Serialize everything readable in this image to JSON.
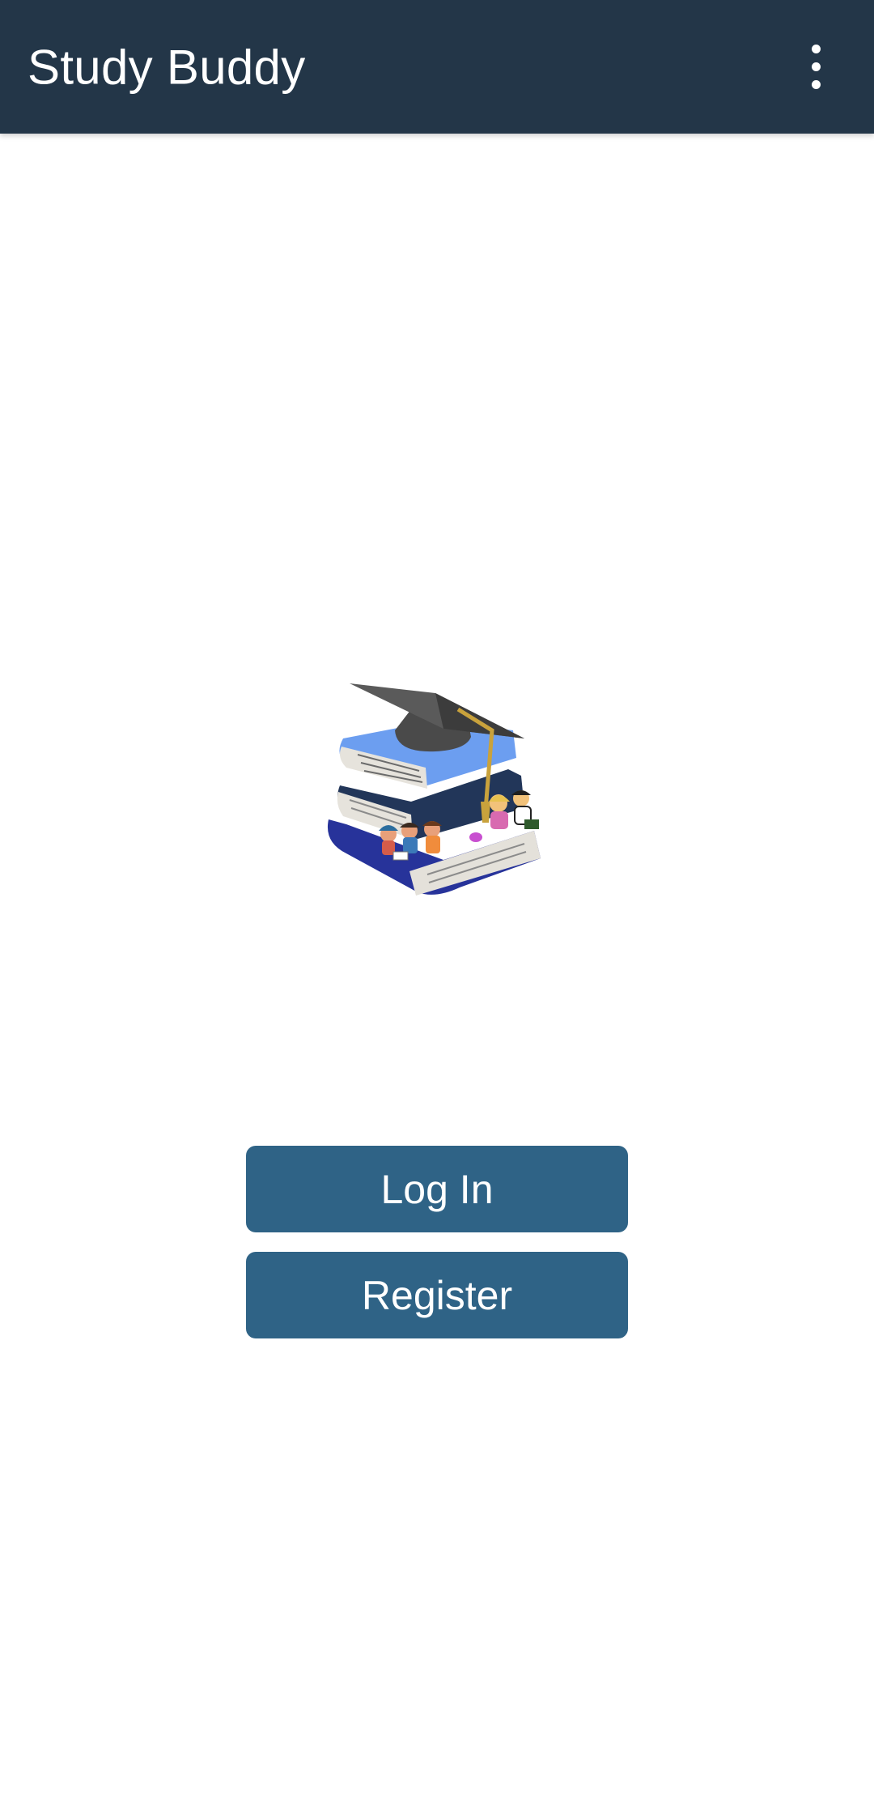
{
  "app_bar": {
    "title": "Study Buddy",
    "menu_icon": "more-vert-icon",
    "background": "#233648"
  },
  "logo": {
    "icon": "graduation-books-logo"
  },
  "actions": {
    "login_label": "Log In",
    "register_label": "Register",
    "button_color": "#2f6386"
  }
}
